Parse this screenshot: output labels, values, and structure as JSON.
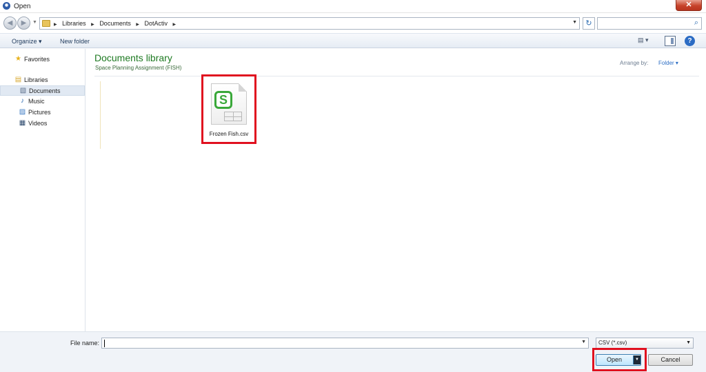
{
  "window": {
    "title": "Open",
    "close_glyph": "✕"
  },
  "address_bar": {
    "crumbs": [
      "Libraries",
      "Documents",
      "DotActiv"
    ],
    "back_glyph": "◀",
    "forward_glyph": "▶",
    "refresh_glyph": "↻"
  },
  "search": {
    "placeholder": "",
    "icon": "search-icon"
  },
  "toolbar": {
    "organize_label": "Organize ▾",
    "new_folder_label": "New folder",
    "help_glyph": "?"
  },
  "sidebar": {
    "items": [
      {
        "label": "Favorites",
        "icon": "star-icon",
        "glyph": "★",
        "indent": false
      },
      {
        "label": "Libraries",
        "icon": "libraries-icon",
        "glyph": "▤",
        "indent": false
      },
      {
        "label": "Documents",
        "icon": "documents-icon",
        "glyph": "▧",
        "indent": true,
        "selected": true
      },
      {
        "label": "Music",
        "icon": "music-icon",
        "glyph": "♪",
        "indent": true
      },
      {
        "label": "Pictures",
        "icon": "pictures-icon",
        "glyph": "▨",
        "indent": true
      },
      {
        "label": "Videos",
        "icon": "videos-icon",
        "glyph": "▦",
        "indent": true
      }
    ]
  },
  "library": {
    "title": "Documents library",
    "subtitle": "Space Planning Assignment (FISH)",
    "arrange_label": "Arrange by:",
    "arrange_value": "Folder ▾"
  },
  "files": [
    {
      "name": "Frozen Fish.csv",
      "icon": "csv-file-icon",
      "badge": "S",
      "highlighted": true
    }
  ],
  "footer": {
    "file_name_label": "File name:",
    "file_name_value": "",
    "file_type": "CSV (*.csv)",
    "open_label": "Open",
    "cancel_label": "Cancel"
  },
  "colors": {
    "library_title": "#1e7a22",
    "highlight": "#e0101f",
    "accent": "#2a6cc4"
  }
}
